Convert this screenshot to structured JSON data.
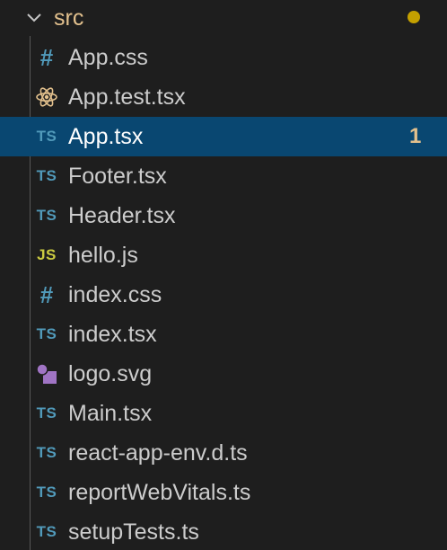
{
  "colors": {
    "background": "#1e1e1e",
    "selected_row": "#094771",
    "folder_text": "#e2c08d",
    "file_text": "#cccccc",
    "modified_dot": "#c4a000",
    "ts_icon": "#519aba",
    "js_icon": "#cbcb41",
    "css_icon": "#519aba",
    "react_icon": "#e2c08d",
    "svg_icon": "#a074c4"
  },
  "folder": {
    "label": "src",
    "chevron_icon": "chevron-down-icon",
    "modified_indicator": "dot"
  },
  "files": [
    {
      "label": "App.css",
      "icon": "css-hash-icon",
      "icon_text": "#",
      "selected": false,
      "badge": ""
    },
    {
      "label": "App.test.tsx",
      "icon": "react-atom-icon",
      "icon_text": "",
      "selected": false,
      "badge": ""
    },
    {
      "label": "App.tsx",
      "icon": "typescript-icon",
      "icon_text": "TS",
      "selected": true,
      "badge": "1"
    },
    {
      "label": "Footer.tsx",
      "icon": "typescript-icon",
      "icon_text": "TS",
      "selected": false,
      "badge": ""
    },
    {
      "label": "Header.tsx",
      "icon": "typescript-icon",
      "icon_text": "TS",
      "selected": false,
      "badge": ""
    },
    {
      "label": "hello.js",
      "icon": "javascript-icon",
      "icon_text": "JS",
      "selected": false,
      "badge": ""
    },
    {
      "label": "index.css",
      "icon": "css-hash-icon",
      "icon_text": "#",
      "selected": false,
      "badge": ""
    },
    {
      "label": "index.tsx",
      "icon": "typescript-icon",
      "icon_text": "TS",
      "selected": false,
      "badge": ""
    },
    {
      "label": "logo.svg",
      "icon": "svg-image-icon",
      "icon_text": "",
      "selected": false,
      "badge": ""
    },
    {
      "label": "Main.tsx",
      "icon": "typescript-icon",
      "icon_text": "TS",
      "selected": false,
      "badge": ""
    },
    {
      "label": "react-app-env.d.ts",
      "icon": "typescript-icon",
      "icon_text": "TS",
      "selected": false,
      "badge": ""
    },
    {
      "label": "reportWebVitals.ts",
      "icon": "typescript-icon",
      "icon_text": "TS",
      "selected": false,
      "badge": ""
    },
    {
      "label": "setupTests.ts",
      "icon": "typescript-icon",
      "icon_text": "TS",
      "selected": false,
      "badge": ""
    }
  ]
}
